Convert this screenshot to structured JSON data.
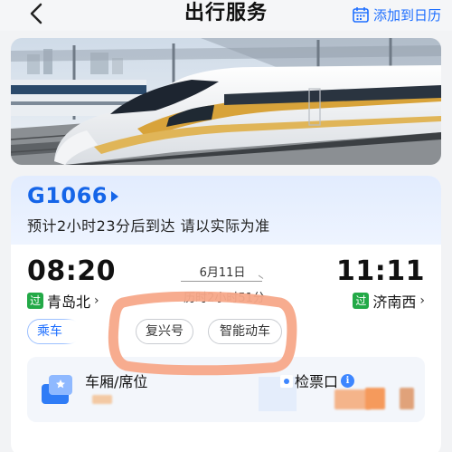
{
  "nav": {
    "title": "出行服务",
    "add_calendar": "添加到日历",
    "back_icon": "chevron-left-icon",
    "calendar_icon": "calendar-icon"
  },
  "banner": {
    "image": "high-speed-train-photo"
  },
  "trip": {
    "train_number": "G1066",
    "eta_text": "预计2小时23分后到达 请以实际为准",
    "departure": {
      "time": "08:20",
      "tag": "过",
      "station": "青岛北"
    },
    "arrival": {
      "time": "11:11",
      "tag": "过",
      "station": "济南西"
    },
    "date": "6月11日",
    "duration": "历时2小时51分",
    "chips": [
      "乘车",
      "复兴号",
      "智能动车"
    ]
  },
  "seat": {
    "label": "车厢/席位",
    "gate_label": "检票口"
  },
  "colors": {
    "accent": "#1e6fff",
    "train_no": "#1565e8",
    "tag_green": "#23a947",
    "annotation": "#f7a889"
  }
}
